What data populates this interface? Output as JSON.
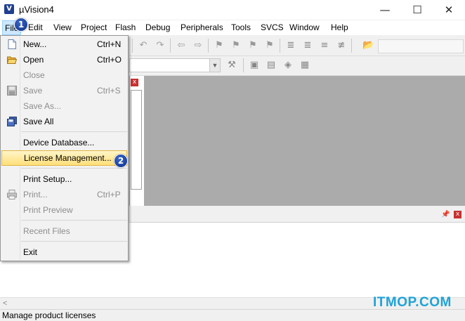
{
  "window": {
    "title": "µVision4",
    "app_icon": "V",
    "minimize_glyph": "—",
    "maximize_glyph": "☐",
    "close_glyph": "✕"
  },
  "menubar": {
    "items": [
      "File",
      "Edit",
      "View",
      "Project",
      "Flash",
      "Debug",
      "Peripherals",
      "Tools",
      "SVCS",
      "Window",
      "Help"
    ]
  },
  "file_menu": {
    "items": [
      {
        "label": "New...",
        "shortcut": "Ctrl+N",
        "enabled": true,
        "icon": "new-file-icon"
      },
      {
        "label": "Open",
        "shortcut": "Ctrl+O",
        "enabled": true,
        "icon": "open-folder-icon"
      },
      {
        "label": "Close",
        "shortcut": "",
        "enabled": false
      },
      {
        "label": "Save",
        "shortcut": "Ctrl+S",
        "enabled": false,
        "icon": "save-icon"
      },
      {
        "label": "Save As...",
        "shortcut": "",
        "enabled": false
      },
      {
        "label": "Save All",
        "shortcut": "",
        "enabled": true,
        "icon": "save-all-icon"
      },
      {
        "label": "Device Database...",
        "shortcut": "",
        "enabled": true
      },
      {
        "label": "License Management...",
        "shortcut": "",
        "enabled": true,
        "highlighted": true
      },
      {
        "label": "Print Setup...",
        "shortcut": "",
        "enabled": true
      },
      {
        "label": "Print...",
        "shortcut": "Ctrl+P",
        "enabled": false,
        "icon": "print-icon"
      },
      {
        "label": "Print Preview",
        "shortcut": "",
        "enabled": false
      },
      {
        "label": "Recent Files",
        "shortcut": "",
        "enabled": false
      },
      {
        "label": "Exit",
        "shortcut": "",
        "enabled": true
      }
    ]
  },
  "badges": {
    "one": "1",
    "two": "2"
  },
  "statusbar": {
    "text": "Manage product licenses"
  },
  "watermark": {
    "text": "ITMOP.COM"
  },
  "colors": {
    "highlight_top": "#fff5c8",
    "highlight_bottom": "#ffdf7a",
    "badge": "#1a3f9e",
    "editor_bg": "#ababab",
    "watermark": "#1fa3d9"
  }
}
